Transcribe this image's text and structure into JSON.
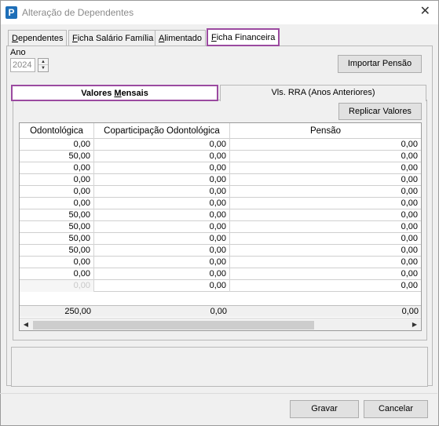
{
  "window": {
    "title": "Alteração de Dependentes",
    "icon_letter": "P",
    "close_glyph": "✕"
  },
  "tabs": [
    {
      "label_ul": "D",
      "label_rest": "ependentes"
    },
    {
      "label_ul": "F",
      "label_rest": "icha Salário Família"
    },
    {
      "label_ul": "A",
      "label_rest": "limentado"
    },
    {
      "label_ul": "F",
      "label_rest": "icha Financeira",
      "active": true
    }
  ],
  "filters": {
    "ano_label": "Ano",
    "ano_value": "2024"
  },
  "buttons": {
    "importar_pensao": "Importar Pensão",
    "replicar_valores": "Replicar Valores",
    "gravar": "Gravar",
    "cancelar": "Cancelar"
  },
  "subtabs": {
    "valores_mensais_pre": "Valores ",
    "valores_mensais_ul": "M",
    "valores_mensais_post": "ensais",
    "vls_rra": "Vls. RRA (Anos Anteriores)"
  },
  "grid": {
    "columns": [
      "Odontológica",
      "Coparticipação Odontológica",
      "Pensão"
    ],
    "rows": [
      [
        "0,00",
        "0,00",
        "0,00"
      ],
      [
        "50,00",
        "0,00",
        "0,00"
      ],
      [
        "0,00",
        "0,00",
        "0,00"
      ],
      [
        "0,00",
        "0,00",
        "0,00"
      ],
      [
        "0,00",
        "0,00",
        "0,00"
      ],
      [
        "0,00",
        "0,00",
        "0,00"
      ],
      [
        "50,00",
        "0,00",
        "0,00"
      ],
      [
        "50,00",
        "0,00",
        "0,00"
      ],
      [
        "50,00",
        "0,00",
        "0,00"
      ],
      [
        "50,00",
        "0,00",
        "0,00"
      ],
      [
        "0,00",
        "0,00",
        "0,00"
      ],
      [
        "0,00",
        "0,00",
        "0,00"
      ],
      [
        "0,00",
        "0,00",
        "0,00"
      ]
    ],
    "dim_last_first_cell": true,
    "totals": [
      "250,00",
      "0,00",
      "0,00"
    ]
  },
  "colors": {
    "highlight": "#9b4aa0",
    "brand": "#1e6fb8"
  }
}
